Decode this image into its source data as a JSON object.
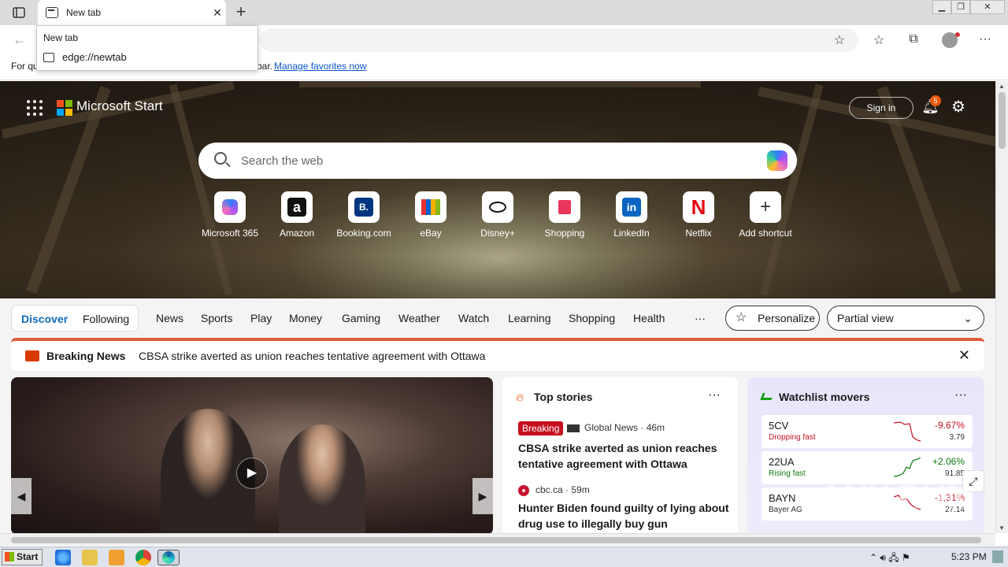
{
  "browser": {
    "tab_title": "New tab",
    "address_dropdown": {
      "heading": "New tab",
      "url": "edge://newtab"
    },
    "favorites_bar": {
      "prefix": "For qu",
      "middle": "bar.",
      "link": "Manage favorites now"
    }
  },
  "page": {
    "brand": "Microsoft Start",
    "sign_in": "Sign in",
    "notification_count": "5",
    "search": {
      "placeholder": "Search the web"
    },
    "tiles": [
      {
        "label": "Microsoft 365",
        "icon": "microsoft-365-icon"
      },
      {
        "label": "Amazon",
        "icon": "amazon-icon",
        "glyph": "a"
      },
      {
        "label": "Booking.com",
        "icon": "booking-icon",
        "glyph": "B."
      },
      {
        "label": "eBay",
        "icon": "ebay-icon"
      },
      {
        "label": "Disney+",
        "icon": "disney-icon"
      },
      {
        "label": "Shopping",
        "icon": "shopping-icon"
      },
      {
        "label": "LinkedIn",
        "icon": "linkedin-icon",
        "glyph": "in"
      },
      {
        "label": "Netflix",
        "icon": "netflix-icon",
        "glyph": "N"
      },
      {
        "label": "Add shortcut",
        "icon": "plus-icon",
        "glyph": "+"
      }
    ],
    "nav": {
      "discover": "Discover",
      "following": "Following",
      "items": [
        "News",
        "Sports",
        "Play",
        "Money",
        "Gaming",
        "Weather",
        "Watch",
        "Learning",
        "Shopping",
        "Health"
      ],
      "more": "···",
      "personalize": "Personalize",
      "view": "Partial view"
    },
    "breaking": {
      "label": "Breaking News",
      "headline": "CBSA strike averted as union reaches tentative agreement with Ottawa"
    },
    "top_stories": {
      "title": "Top stories",
      "more": "···",
      "badge": "Breaking",
      "story1_source": "Global News · 46m",
      "story1_headline": "CBSA strike averted as union reaches tentative agreement with Ottawa",
      "story2_source": "cbc.ca · 59m",
      "story2_headline": "Hunter Biden found guilty of lying about drug use to illegally buy gun"
    },
    "watchlist": {
      "title": "Watchlist movers",
      "more": "···",
      "stocks": [
        {
          "symbol": "5CV",
          "sub": "Dropping fast",
          "pct": "-9.67%",
          "price": "3.79",
          "color": "#c50f1f"
        },
        {
          "symbol": "22UA",
          "sub": "Rising fast",
          "pct": "+2.06%",
          "price": "91.85",
          "color": "#0e7a0d"
        },
        {
          "symbol": "BAYN",
          "sub": "Bayer AG",
          "pct": "-1.31%",
          "price": "27.14",
          "color": "#c50f1f"
        }
      ]
    },
    "watermark": "ANY.RUN"
  },
  "taskbar": {
    "start": "Start",
    "time": "5:23 PM"
  }
}
